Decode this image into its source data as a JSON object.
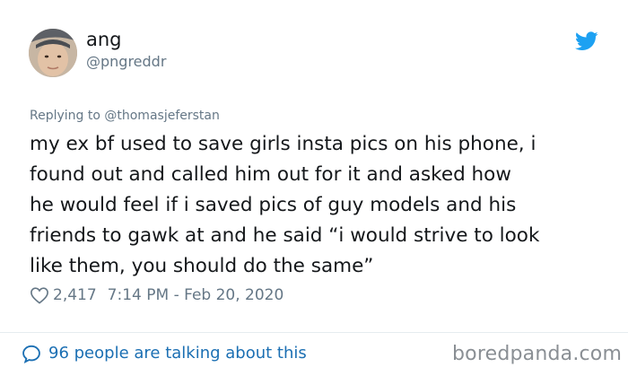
{
  "user": {
    "display_name": "ang",
    "handle": "@pngreddr"
  },
  "tweet": {
    "reply_to": "Replying to @thomasjeferstan",
    "text": "my ex bf used to save girls insta pics on his phone, i\nfound out and called him out for it and asked how\nhe would feel if i saved pics of guy models and his\nfriends to gawk at and he said “i would strive to look\nlike them, you should do the same”",
    "likes": "2,417",
    "timestamp": "7:14 PM - Feb 20, 2020"
  },
  "footer": {
    "talking": "96 people are talking about this",
    "watermark": "boredpanda.com"
  },
  "icons": {
    "brand": "twitter-bird-icon",
    "like": "heart-icon",
    "reply": "speech-bubble-icon"
  },
  "colors": {
    "twitter_blue": "#1da1f2",
    "link_blue": "#1b6fb3",
    "secondary_text": "#657786"
  }
}
